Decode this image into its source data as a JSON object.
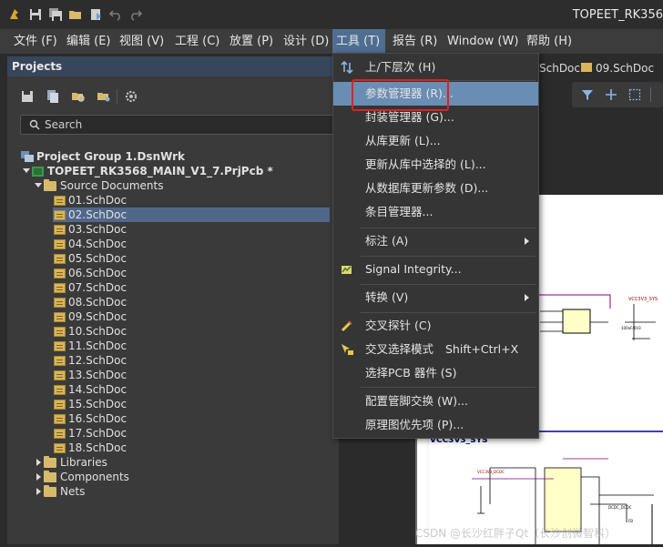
{
  "app": {
    "title": "TOPEET_RK356"
  },
  "menubar": {
    "items": [
      {
        "label": "文件 (F)"
      },
      {
        "label": "编辑 (E)"
      },
      {
        "label": "视图 (V)"
      },
      {
        "label": "工程 (C)"
      },
      {
        "label": "放置 (P)"
      },
      {
        "label": "设计 (D)"
      },
      {
        "label": "工具 (T)"
      },
      {
        "label": "报告 (R)"
      },
      {
        "label": "Window (W)"
      },
      {
        "label": "帮助 (H)"
      }
    ]
  },
  "projects_panel": {
    "title": "Projects",
    "search_placeholder": "Search",
    "tree": {
      "group": "Project Group 1.DsnWrk",
      "project": "TOPEET_RK3568_MAIN_V1_7.PrjPcb *",
      "source_folder": "Source Documents",
      "documents": [
        "01.SchDoc",
        "02.SchDoc",
        "03.SchDoc",
        "04.SchDoc",
        "05.SchDoc",
        "06.SchDoc",
        "07.SchDoc",
        "08.SchDoc",
        "09.SchDoc",
        "10.SchDoc",
        "11.SchDoc",
        "12.SchDoc",
        "13.SchDoc",
        "14.SchDoc",
        "15.SchDoc",
        "16.SchDoc",
        "17.SchDoc",
        "18.SchDoc"
      ],
      "selected_document": "02.SchDoc",
      "folders": [
        "Libraries",
        "Components",
        "Nets"
      ]
    }
  },
  "doc_tabs": [
    {
      "label": "SchDoc"
    },
    {
      "label": "09.SchDoc"
    }
  ],
  "schematic": {
    "net_label": "VCC3V3_SYS"
  },
  "tools_menu": {
    "items": [
      {
        "label": "上/下层次 (H)",
        "icon": "hierarchy-arrows-icon"
      },
      {
        "label": "参数管理器 (R)...",
        "highlighted": true
      },
      {
        "label": "封装管理器 (G)..."
      },
      {
        "label": "从库更新 (L)..."
      },
      {
        "label": "更新从库中选择的 (L)..."
      },
      {
        "label": "从数据库更新参数 (D)..."
      },
      {
        "label": "条目管理器..."
      },
      {
        "label": "标注 (A)",
        "submenu": true
      },
      {
        "label": "Signal Integrity...",
        "icon": "signal-integrity-icon"
      },
      {
        "label": "转换 (V)",
        "submenu": true
      },
      {
        "label": "交叉探针 (C)",
        "icon": "cross-probe-icon"
      },
      {
        "label": "交叉选择模式",
        "shortcut": "Shift+Ctrl+X",
        "icon": "cross-select-icon"
      },
      {
        "label": "选择PCB 器件 (S)"
      },
      {
        "label": "配置管脚交换 (W)..."
      },
      {
        "label": "原理图优先项 (P)..."
      }
    ]
  },
  "watermark": "CSDN @长沙红胖子Qt（长沙创微智科）",
  "colors": {
    "accent": "#4f6e92",
    "highlight_box": "#e02020",
    "selection": "#51678a"
  }
}
